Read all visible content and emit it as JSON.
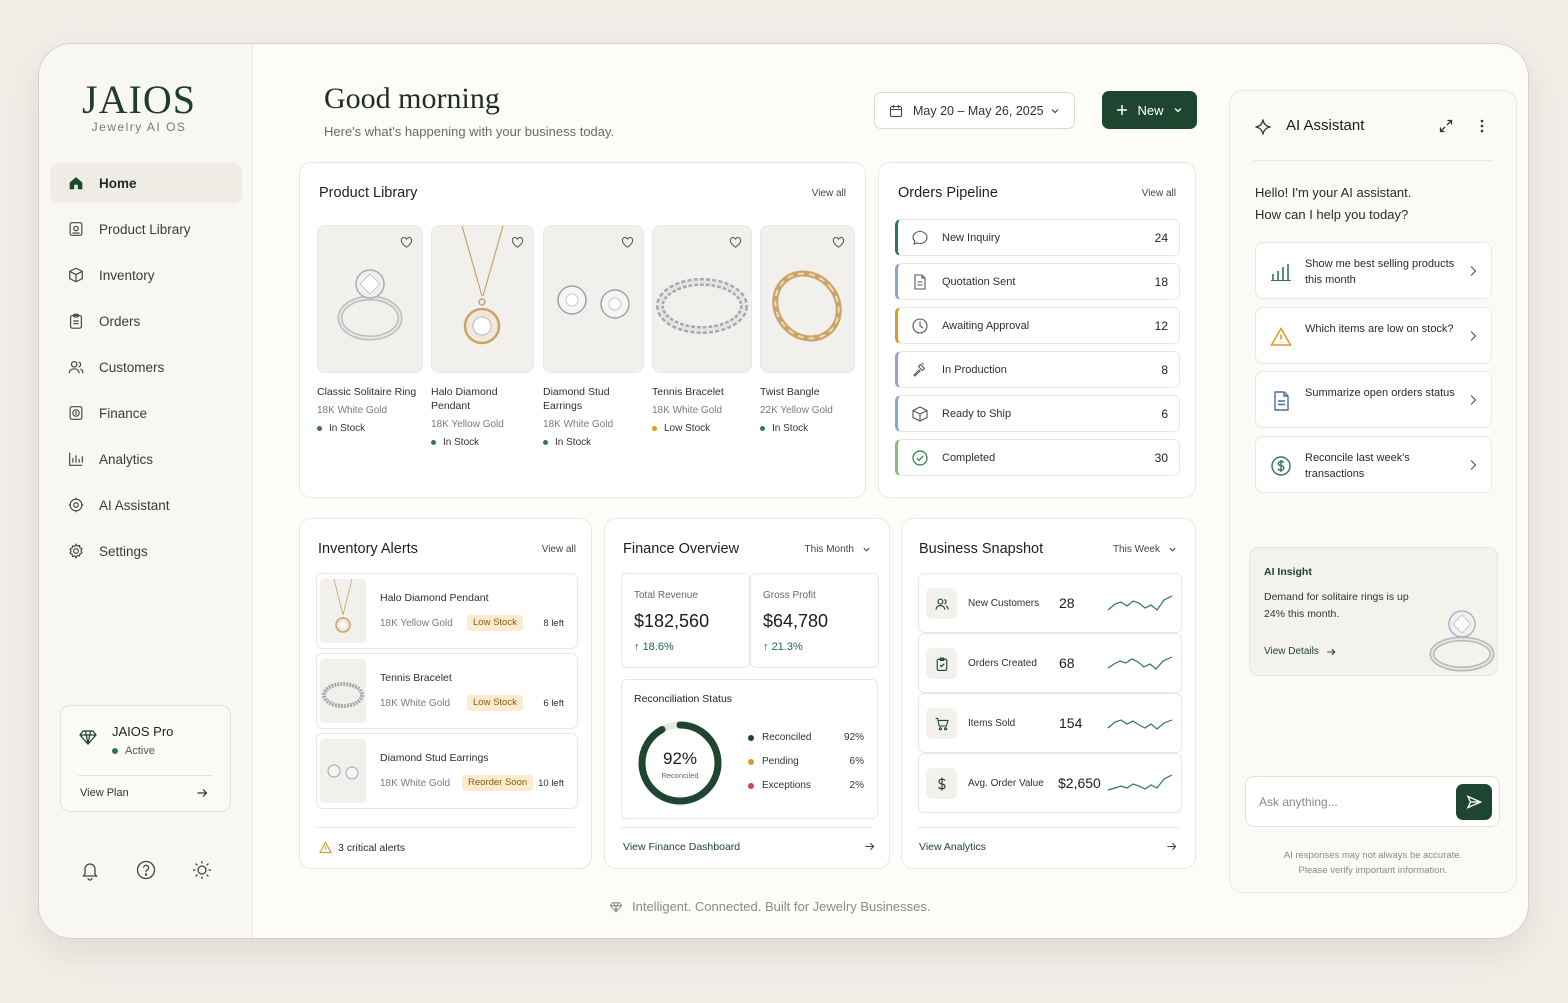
{
  "sidebar": {
    "logo": "JAIOS",
    "logo_sub": "Jewelry AI OS",
    "nav": [
      {
        "label": "Home",
        "icon": "home-icon"
      },
      {
        "label": "Product Library",
        "icon": "product-library-icon"
      },
      {
        "label": "Inventory",
        "icon": "box-icon"
      },
      {
        "label": "Orders",
        "icon": "clipboard-icon"
      },
      {
        "label": "Customers",
        "icon": "users-icon"
      },
      {
        "label": "Finance",
        "icon": "wallet-icon"
      },
      {
        "label": "Analytics",
        "icon": "bar-chart-icon"
      },
      {
        "label": "AI Assistant",
        "icon": "ai-icon"
      },
      {
        "label": "Settings",
        "icon": "gear-icon"
      }
    ],
    "plan": {
      "name": "JAIOS Pro",
      "status": "Active",
      "link": "View Plan"
    }
  },
  "header": {
    "greeting": "Good morning",
    "subtitle": "Here's what's happening with your business today.",
    "date_range": "May 20 – May 26, 2025",
    "new_label": "New"
  },
  "product_library": {
    "title": "Product Library",
    "view_all": "View all",
    "items": [
      {
        "name": "Classic Solitaire Ring",
        "material": "18K White Gold",
        "stock": "In Stock",
        "stock_color": "#2f7a4c"
      },
      {
        "name": "Halo Diamond Pendant",
        "material": "18K Yellow Gold",
        "stock": "In Stock",
        "stock_color": "#2f7a4c"
      },
      {
        "name": "Diamond Stud Earrings",
        "material": "18K White Gold",
        "stock": "In Stock",
        "stock_color": "#2f7a4c"
      },
      {
        "name": "Tennis Bracelet",
        "material": "18K White Gold",
        "stock": "Low Stock",
        "stock_color": "#d99a26"
      },
      {
        "name": "Twist Bangle",
        "material": "22K Yellow Gold",
        "stock": "In Stock",
        "stock_color": "#2f7a4c"
      }
    ]
  },
  "orders_pipeline": {
    "title": "Orders Pipeline",
    "view_all": "View all",
    "stages": [
      {
        "label": "New Inquiry",
        "count": "24",
        "color": "#2f7a4c",
        "icon": "chat-icon"
      },
      {
        "label": "Quotation Sent",
        "count": "18",
        "color": "#8aa6c9",
        "icon": "document-icon"
      },
      {
        "label": "Awaiting Approval",
        "count": "12",
        "color": "#d99a26",
        "icon": "clock-icon"
      },
      {
        "label": "In Production",
        "count": "8",
        "color": "#a99bc7",
        "icon": "hammer-icon"
      },
      {
        "label": "Ready to Ship",
        "count": "6",
        "color": "#8aa6c9",
        "icon": "package-icon"
      },
      {
        "label": "Completed",
        "count": "30",
        "color": "#8dbb7c",
        "icon": "check-circle-icon"
      }
    ]
  },
  "inventory_alerts": {
    "title": "Inventory Alerts",
    "view_all": "View all",
    "items": [
      {
        "name": "Halo Diamond Pendant",
        "material": "18K Yellow Gold",
        "badge": "Low Stock",
        "left": "8 left"
      },
      {
        "name": "Tennis Bracelet",
        "material": "18K White Gold",
        "badge": "Low Stock",
        "left": "6 left"
      },
      {
        "name": "Diamond Stud Earrings",
        "material": "18K White Gold",
        "badge": "Reorder Soon",
        "left": "10 left"
      }
    ],
    "footer": "3 critical alerts"
  },
  "finance": {
    "title": "Finance Overview",
    "period": "This Month",
    "revenue_label": "Total Revenue",
    "revenue": "$182,560",
    "revenue_change": "18.6%",
    "profit_label": "Gross Profit",
    "profit": "$64,780",
    "profit_change": "21.3%",
    "recon_title": "Reconciliation Status",
    "recon_pct": "92%",
    "recon_pct_value": 0.92,
    "recon_center_label": "Reconciled",
    "legend": [
      {
        "label": "Reconciled",
        "pct": "92%",
        "color": "#1e4530"
      },
      {
        "label": "Pending",
        "pct": "6%",
        "color": "#d99a26"
      },
      {
        "label": "Exceptions",
        "pct": "2%",
        "color": "#c24a4a"
      }
    ],
    "footer": "View Finance Dashboard"
  },
  "snapshot": {
    "title": "Business Snapshot",
    "period": "This Week",
    "rows": [
      {
        "label": "New Customers",
        "value": "28",
        "icon": "users-icon"
      },
      {
        "label": "Orders Created",
        "value": "68",
        "icon": "clipboard-icon"
      },
      {
        "label": "Items Sold",
        "value": "154",
        "icon": "cart-icon"
      },
      {
        "label": "Avg. Order Value",
        "value": "$2,650",
        "icon": "dollar-icon"
      }
    ],
    "footer": "View Analytics"
  },
  "footer_tagline": "Intelligent. Connected. Built for Jewelry Businesses.",
  "ai": {
    "title": "AI Assistant",
    "greeting_line1": "Hello! I'm your AI assistant.",
    "greeting_line2": "How can I help you today?",
    "suggestions": [
      {
        "text": "Show me best selling products this month",
        "icon": "bar-chart-icon"
      },
      {
        "text": "Which items are low on stock?",
        "icon": "warning-icon"
      },
      {
        "text": "Summarize open orders status",
        "icon": "document-icon"
      },
      {
        "text": "Reconcile last week's transactions",
        "icon": "dollar-circle-icon"
      }
    ],
    "insight_title": "AI Insight",
    "insight_text": "Demand for solitaire rings is up 24% this month.",
    "insight_link": "View Details",
    "input_placeholder": "Ask anything...",
    "disclaimer_line1": "AI responses may not always be accurate.",
    "disclaimer_line2": "Please verify important information."
  }
}
